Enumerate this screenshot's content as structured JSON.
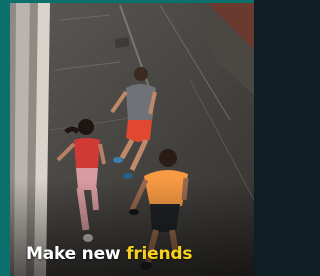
{
  "caption": {
    "prefix": "Make new",
    "highlight": "friends"
  },
  "colors": {
    "accent_teal": "#0b6f6c",
    "highlight_yellow": "#f7d11e",
    "caption_white": "#ffffff"
  },
  "photo": {
    "subject": "three runners jogging on a street"
  }
}
